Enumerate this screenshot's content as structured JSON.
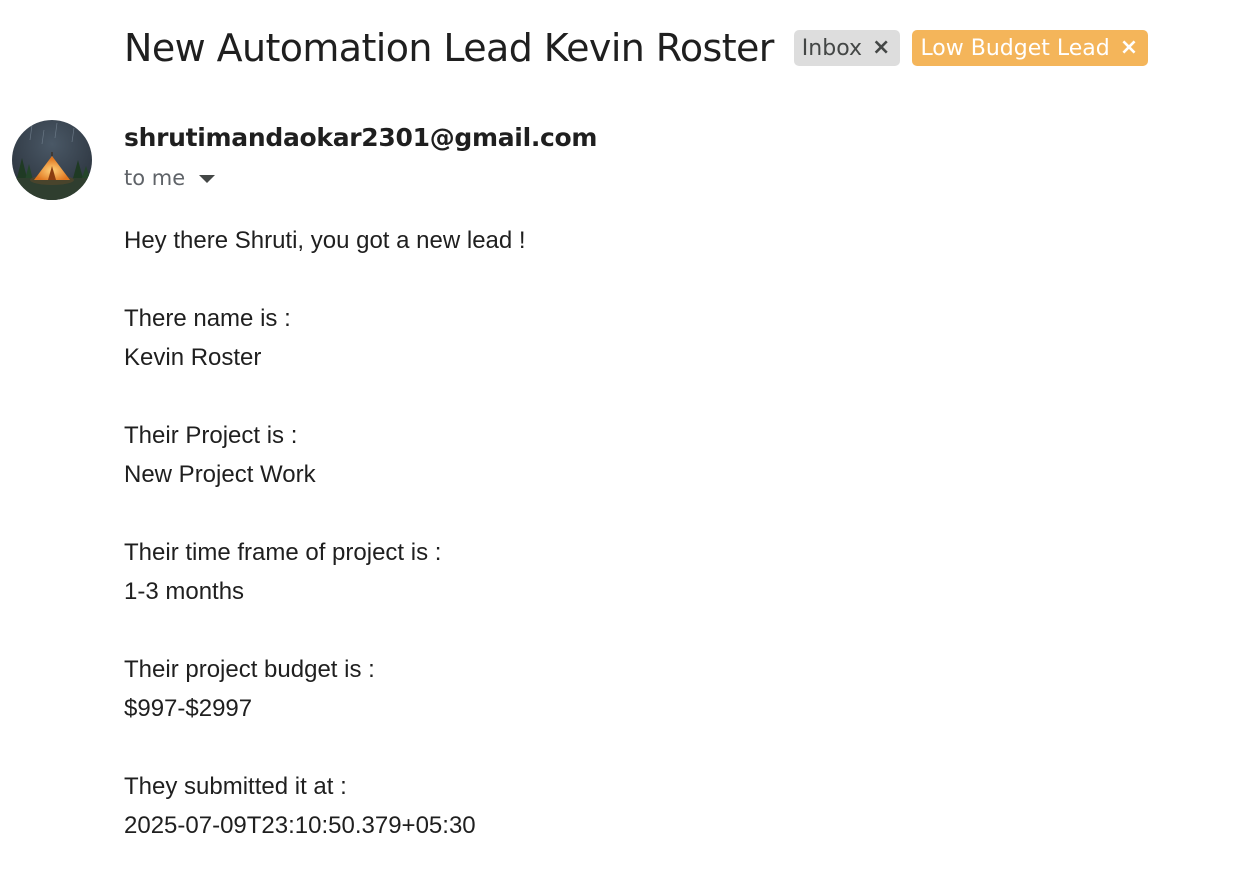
{
  "email": {
    "subject": "New Automation Lead Kevin Roster",
    "labels": [
      {
        "name": "Inbox",
        "remove_glyph": "×",
        "color": "#dddddd"
      },
      {
        "name": "Low Budget Lead",
        "remove_glyph": "×",
        "color": "#f4b55a"
      }
    ],
    "sender": "shrutimandaokar2301@gmail.com",
    "avatar_icon": "camp-tent-icon",
    "recipient_label": "to me",
    "body_lines": [
      "Hey there Shruti, you got a new lead !",
      "",
      "There name is :",
      "Kevin Roster",
      "",
      "Their Project is :",
      "New Project Work",
      "",
      "Their time frame of project is :",
      "1-3 months",
      "",
      "Their project budget is :",
      "$997-$2997",
      "",
      "They submitted it at :",
      "2025-07-09T23:10:50.379+05:30"
    ]
  }
}
